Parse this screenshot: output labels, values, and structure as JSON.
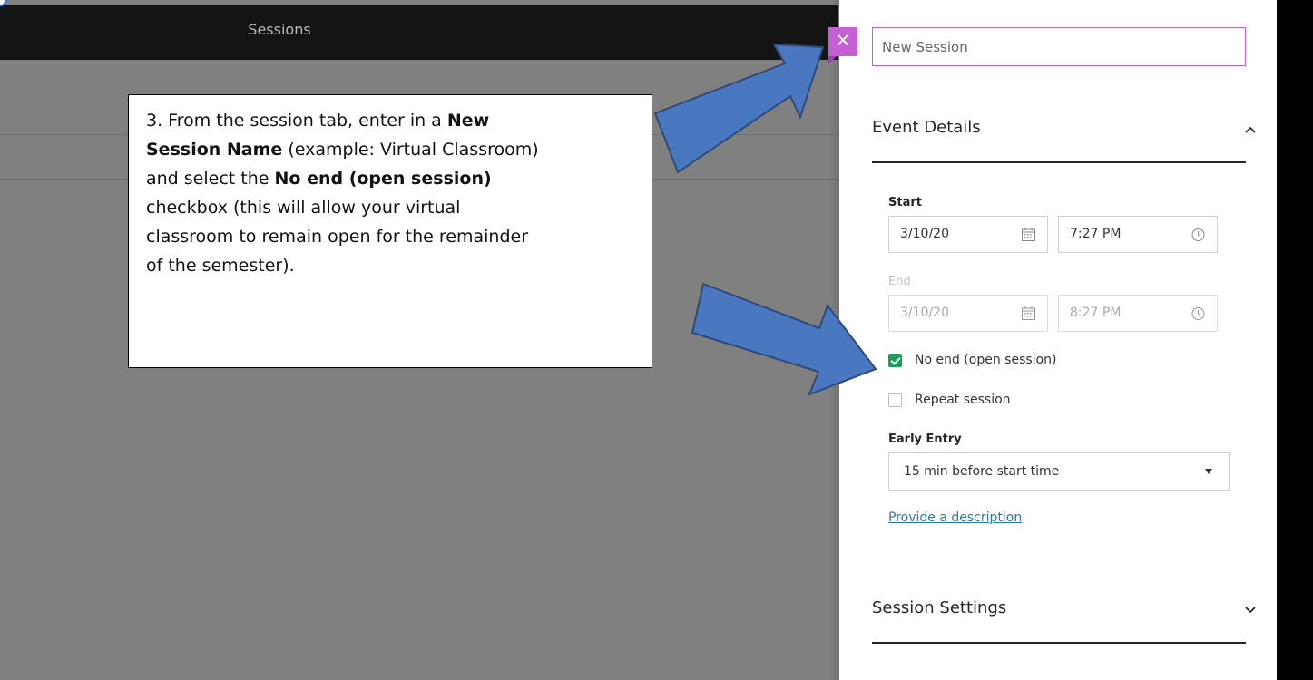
{
  "header": {
    "title": "Sessions"
  },
  "callout": {
    "line1_prefix": "3. From the session tab, enter in a ",
    "line1_bold": "New",
    "line2_bold": "Session Name",
    "line2_rest": " (example: Virtual Classroom)",
    "line3_prefix": "and select the ",
    "line3_bold": "No end (open session)",
    "line4": "checkbox (this will allow your virtual",
    "line5": "classroom to remain open for the remainder",
    "line6": "of the semester)."
  },
  "panel": {
    "close_symbol": "×",
    "session_name_placeholder": "New Session",
    "event_details_title": "Event Details",
    "start_label": "Start",
    "start_date": "3/10/20",
    "start_time": "7:27 PM",
    "end_label": "End",
    "end_date": "3/10/20",
    "end_time": "8:27 PM",
    "no_end_label": "No end (open session)",
    "no_end_checked": true,
    "repeat_label": "Repeat session",
    "repeat_checked": false,
    "early_entry_label": "Early Entry",
    "early_entry_value": "15 min before start time",
    "description_link": "Provide a description",
    "session_settings_title": "Session Settings"
  },
  "colors": {
    "accent": "#c45fd6",
    "checkbox_green": "#1a9c5b",
    "link_blue": "#2a7ab0",
    "arrow_fill": "#4a78c0",
    "arrow_stroke": "#2e4a7a"
  },
  "icons": [
    "close-icon",
    "calendar-icon",
    "clock-icon",
    "chevron-up-icon",
    "chevron-down-icon",
    "caret-down-icon",
    "check-icon"
  ]
}
